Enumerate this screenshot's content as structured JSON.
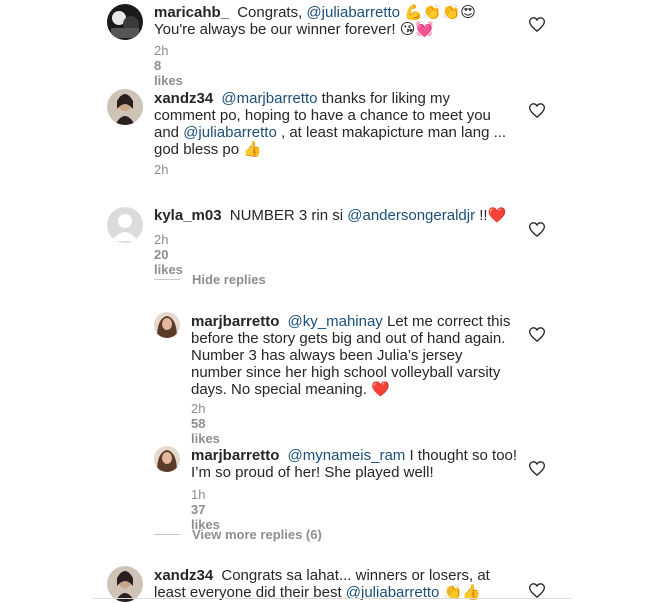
{
  "comments": [
    {
      "username": "maricahb_",
      "pre": "Congrats, ",
      "mention": "@juliabarretto",
      "post": "",
      "emoji1": "💪👏👏😍",
      "line2": "You're always be our winner forever!",
      "emoji2": "😘💓",
      "time": "2h",
      "likes": "8 likes"
    },
    {
      "username": "xandz34",
      "mention1": "@marjbarretto",
      "text1": " thanks for liking my",
      "line2": "comment po, hoping to have a chance to meet you",
      "line3_pre": "and ",
      "mention2": "@juliabarretto",
      "line3_post": " , at least makapicture man lang ...",
      "line4": "god bless po",
      "emoji": "👍",
      "time": "2h"
    },
    {
      "username": "kyla_m03",
      "text": "NUMBER 3 rin si ",
      "mention": "@andersongeraldjr",
      "post": " !!",
      "emoji": "❤️",
      "time": "2h",
      "likes": "20 likes"
    }
  ],
  "hide_replies": "Hide replies",
  "replies": [
    {
      "username": "marjbarretto",
      "mention": "@ky_mahinay",
      "line1": " Let me correct this",
      "line2": "before the story gets big and out of hand again.",
      "line3": "Number 3 has always been Julia’s jersey",
      "line4": "number since her high school volleyball varsity",
      "line5": "days. No special meaning.",
      "emoji": "❤️",
      "time": "2h",
      "likes": "58 likes"
    },
    {
      "username": "marjbarretto",
      "mention": "@mynameis_ram",
      "line1": " I thought so too!",
      "line2": "I’m so proud of her! She played well!",
      "time": "1h",
      "likes": "37 likes"
    }
  ],
  "view_more": "View more replies (6)",
  "last_comment": {
    "username": "xandz34",
    "line1": "Congrats sa lahat... winners or losers, at",
    "line2_pre": "least everyone did their best ",
    "mention": "@juliabarretto",
    "emoji": "👏👍"
  }
}
